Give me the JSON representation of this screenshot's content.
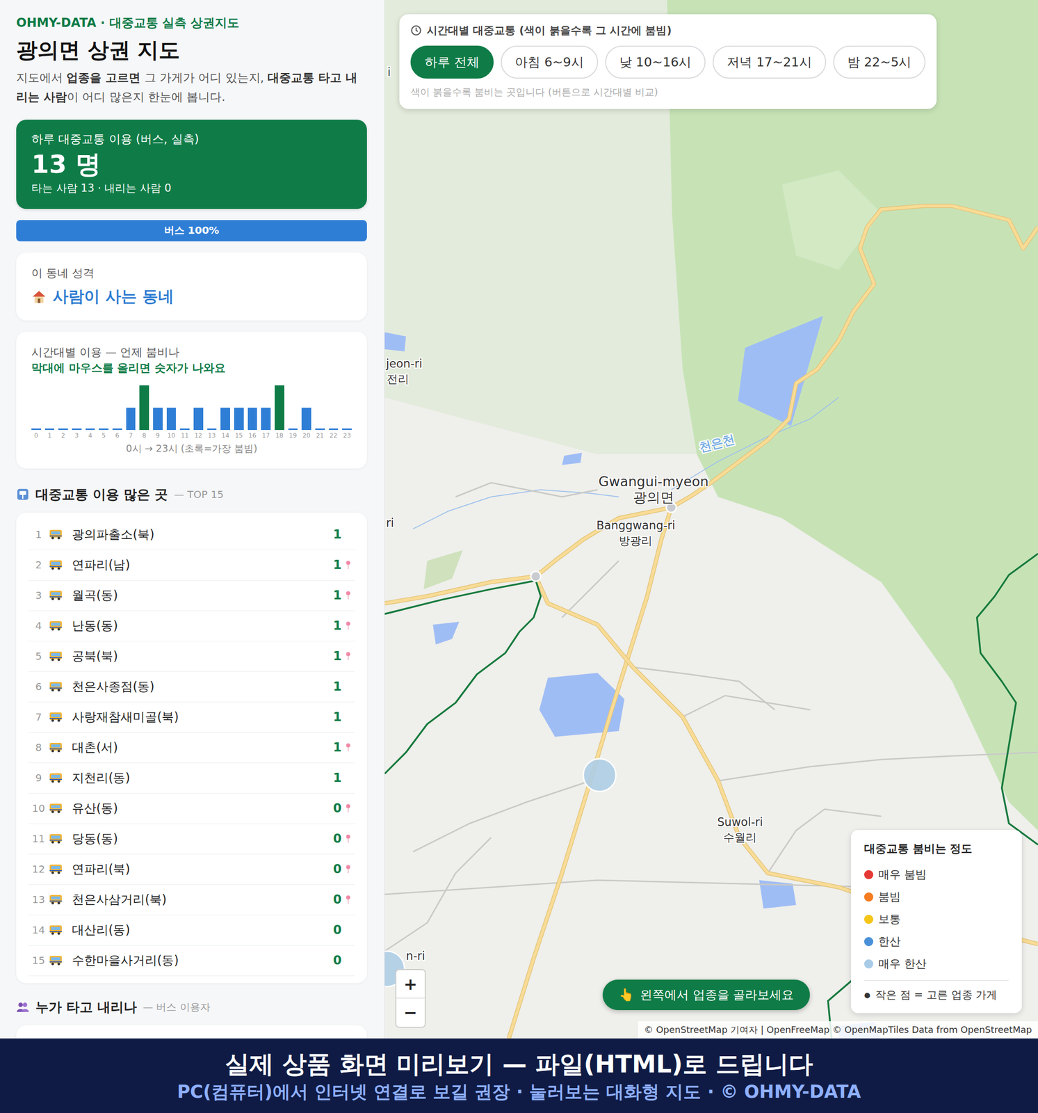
{
  "header": {
    "brand": "OHMY-DATA · 대중교통 실측 상권지도",
    "title": "광의면 상권 지도",
    "description": [
      {
        "text": "지도에서 ",
        "bold": false
      },
      {
        "text": "업종을 고르면",
        "bold": true
      },
      {
        "text": " 그 가게가 어디 있는지, ",
        "bold": false
      },
      {
        "text": "대중교통 타고 내리는 사람",
        "bold": true
      },
      {
        "text": "이 어디 많은지 한눈에 봅니다.",
        "bold": false
      }
    ]
  },
  "summary": {
    "label": "하루 대중교통 이용 (버스, 실측)",
    "value": "13 명",
    "detail": "타는 사람 13 · 내리는 사람 0"
  },
  "mode_bar": {
    "label": "버스 100%",
    "level": 1
  },
  "character": {
    "label": "이 동네 성격",
    "value": "사람이 사는 동네"
  },
  "hourly_chart": {
    "title": "시간대별 이용 — 언제 붐비나",
    "hint": "막대에 마우스를 올리면 숫자가 나와요",
    "values": [
      0,
      0,
      0,
      0,
      0,
      0,
      0,
      1,
      2,
      1,
      1,
      0,
      1,
      0,
      1,
      1,
      1,
      1,
      2,
      0,
      1,
      0,
      0,
      0
    ],
    "ticks": [
      "0",
      "1",
      "2",
      "3",
      "4",
      "5",
      "6",
      "7",
      "8",
      "9",
      "10",
      "11",
      "12",
      "13",
      "14",
      "15",
      "16",
      "17",
      "18",
      "19",
      "20",
      "21",
      "22",
      "23"
    ],
    "caption": "0시 → 23시 (초록=가장 붐빔)"
  },
  "top_stops": {
    "title": "대중교통 이용 많은 곳",
    "suffix": "— TOP 15",
    "rows": [
      {
        "rank": "1",
        "name": "광의파출소(북)",
        "count": "1",
        "pinned": false
      },
      {
        "rank": "2",
        "name": "연파리(남)",
        "count": "1",
        "pinned": true
      },
      {
        "rank": "3",
        "name": "월곡(동)",
        "count": "1",
        "pinned": true
      },
      {
        "rank": "4",
        "name": "난동(동)",
        "count": "1",
        "pinned": true
      },
      {
        "rank": "5",
        "name": "공북(북)",
        "count": "1",
        "pinned": true
      },
      {
        "rank": "6",
        "name": "천은사종점(동)",
        "count": "1",
        "pinned": false
      },
      {
        "rank": "7",
        "name": "사랑재참새미골(북)",
        "count": "1",
        "pinned": false
      },
      {
        "rank": "8",
        "name": "대촌(서)",
        "count": "1",
        "pinned": true
      },
      {
        "rank": "9",
        "name": "지천리(동)",
        "count": "1",
        "pinned": false
      },
      {
        "rank": "10",
        "name": "유산(동)",
        "count": "0",
        "pinned": true
      },
      {
        "rank": "11",
        "name": "당동(동)",
        "count": "0",
        "pinned": true
      },
      {
        "rank": "12",
        "name": "연파리(북)",
        "count": "0",
        "pinned": true
      },
      {
        "rank": "13",
        "name": "천은사삼거리(북)",
        "count": "0",
        "pinned": true
      },
      {
        "rank": "14",
        "name": "대산리(동)",
        "count": "0",
        "pinned": false
      },
      {
        "rank": "15",
        "name": "수한마을사거리(동)",
        "count": "0",
        "pinned": false
      }
    ]
  },
  "riders": {
    "title": "누가 타고 내리나",
    "suffix": "— 버스 이용자"
  },
  "time_filter": {
    "title": "시간대별 대중교통 (색이 붉을수록 그 시간에 붐빔)",
    "buttons": [
      {
        "label": "하루 전체",
        "selected": true
      },
      {
        "label": "아침 6~9시",
        "selected": false
      },
      {
        "label": "낮 10~16시",
        "selected": false
      },
      {
        "label": "저녁 17~21시",
        "selected": false
      },
      {
        "label": "밤 22~5시",
        "selected": false
      }
    ],
    "note": "색이 붉을수록 붐비는 곳입니다 (버튼으로 시간대별 비교)"
  },
  "map": {
    "labels": [
      {
        "text": "i",
        "kind": "place"
      },
      {
        "text": "jeon-ri",
        "kind": "place"
      },
      {
        "text": "전리",
        "kind": "place"
      },
      {
        "text": "ri",
        "kind": "place"
      },
      {
        "text": "천은천",
        "kind": "river"
      },
      {
        "text": "Gwangui-myeon",
        "kind": "place"
      },
      {
        "text": "광의면",
        "kind": "place"
      },
      {
        "text": "Banggwang-ri",
        "kind": "place"
      },
      {
        "text": "방광리",
        "kind": "place"
      },
      {
        "text": "Suwol-ri",
        "kind": "place"
      },
      {
        "text": "수월리",
        "kind": "place"
      },
      {
        "text": "n-ri",
        "kind": "place"
      }
    ],
    "stop_markers": [
      {
        "color": "#aecde6"
      },
      {
        "color": "#aecde6"
      }
    ]
  },
  "legend": {
    "title": "대중교통 붐비는 정도",
    "items": [
      {
        "label": "매우 붐빔",
        "color": "#e53935"
      },
      {
        "label": "붐빔",
        "color": "#f57c20"
      },
      {
        "label": "보통",
        "color": "#f5c518"
      },
      {
        "label": "한산",
        "color": "#4a90d9"
      },
      {
        "label": "매우 한산",
        "color": "#a8cbe8"
      }
    ],
    "note_icon": "●",
    "note": "작은 점 = 고른 업종 가게"
  },
  "zoom": {
    "in": "+",
    "out": "−"
  },
  "hint_button": {
    "icon": "👆",
    "label": "왼쪽에서 업종을 골라보세요"
  },
  "attribution": "© OpenStreetMap 기여자 | OpenFreeMap © OpenMapTiles Data from OpenStreetMap",
  "banner": {
    "title": "실제 상품 화면 미리보기 — 파일(HTML)로 드립니다",
    "subtitle": "PC(컴퓨터)에서 인터넷 연결로 보길 권장 · 눌러보는 대화형 지도 · © OHMY-DATA"
  }
}
